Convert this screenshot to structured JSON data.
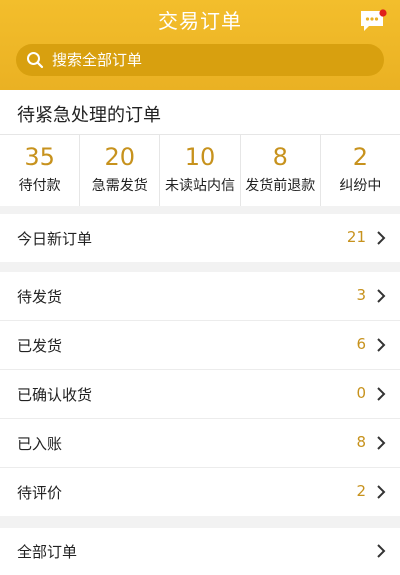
{
  "header": {
    "title": "交易订单",
    "message_icon": "chat-bubble-icon",
    "has_unread_dot": true
  },
  "search": {
    "placeholder": "搜索全部订单",
    "icon": "search-icon"
  },
  "urgent": {
    "title": "待紧急处理的订单",
    "stats": [
      {
        "value": "35",
        "label": "待付款"
      },
      {
        "value": "20",
        "label": "急需发货"
      },
      {
        "value": "10",
        "label": "未读站内信"
      },
      {
        "value": "8",
        "label": "发货前退款"
      },
      {
        "value": "2",
        "label": "纠纷中"
      }
    ]
  },
  "today": {
    "label": "今日新订单",
    "count": "21"
  },
  "statuses": [
    {
      "label": "待发货",
      "count": "3"
    },
    {
      "label": "已发货",
      "count": "6"
    },
    {
      "label": "已确认收货",
      "count": "0"
    },
    {
      "label": "已入账",
      "count": "8"
    },
    {
      "label": "待评价",
      "count": "2"
    }
  ],
  "all_orders": {
    "label": "全部订单"
  },
  "colors": {
    "header": "#eab123",
    "accent": "#c7921d",
    "unread_dot": "#e0201b"
  }
}
